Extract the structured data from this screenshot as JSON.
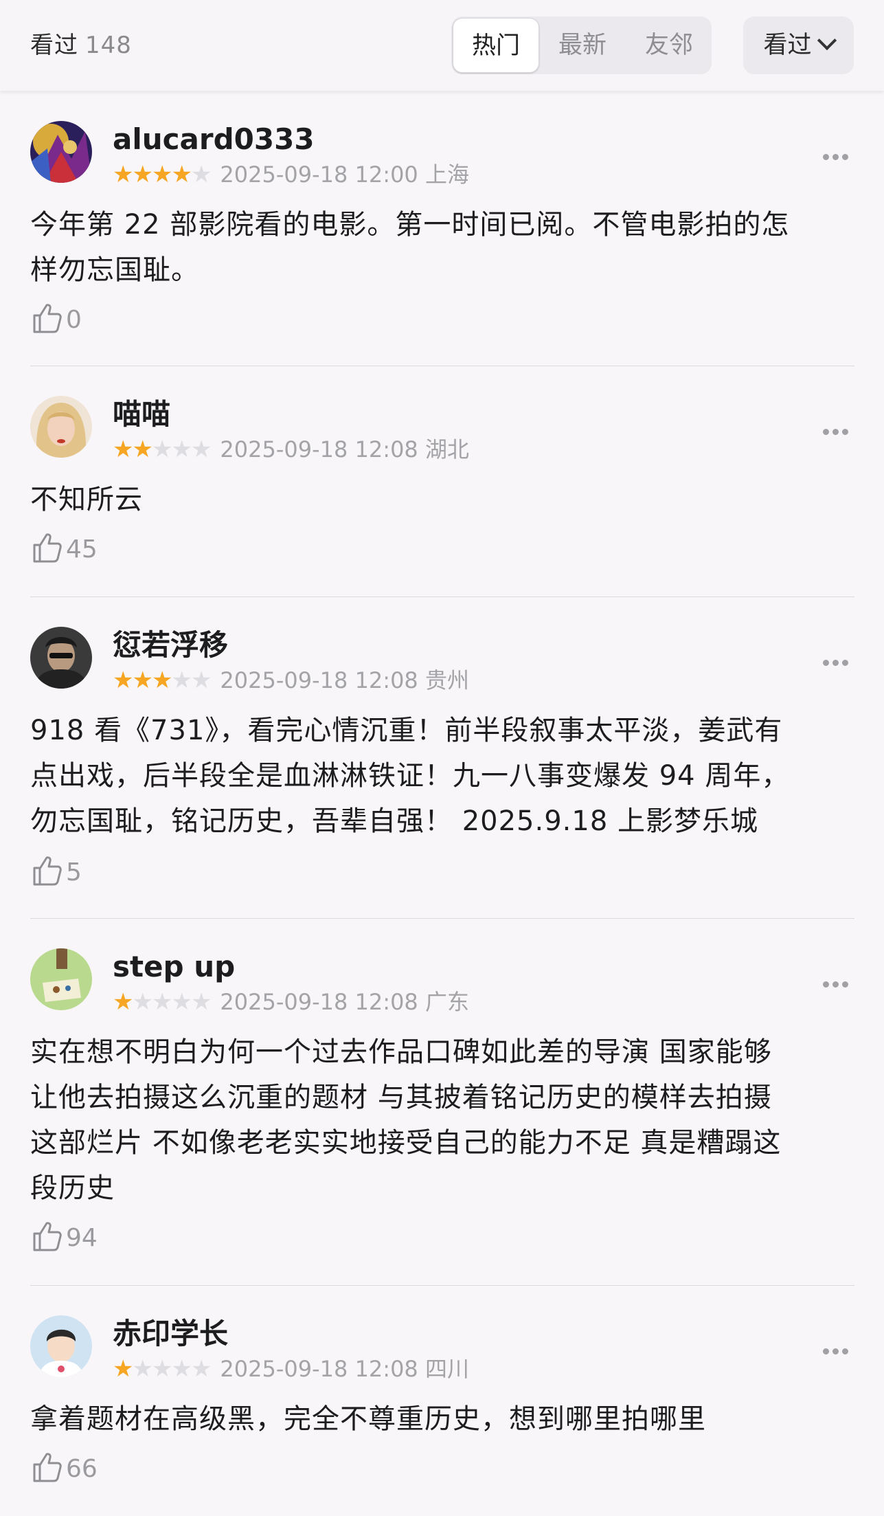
{
  "header": {
    "seen_label": "看过",
    "seen_count": "148",
    "tabs": [
      "热门",
      "最新",
      "友邻"
    ],
    "active_tab": "热门",
    "sort_label": "看过"
  },
  "colors": {
    "star_on": "#f6a623",
    "star_off": "#dedde2"
  },
  "reviews": [
    {
      "user": "alucard0333",
      "stars": 4,
      "date": "2025-09-18 12:00",
      "location": "上海",
      "lines": [
        "今年第 22 部影院看的电影。第一时间已阅。不管电影拍的怎",
        "样勿忘国耻。"
      ],
      "likes": "0"
    },
    {
      "user": "喵喵",
      "stars": 2,
      "date": "2025-09-18 12:08",
      "location": "湖北",
      "lines": [
        "不知所云"
      ],
      "likes": "45"
    },
    {
      "user": "愆若浮移",
      "stars": 3,
      "date": "2025-09-18 12:08",
      "location": "贵州",
      "lines": [
        "918 看《731》，看完心情沉重！前半段叙事太平淡，姜武有",
        "点出戏，后半段全是血淋淋铁证！九一八事变爆发 94 周年，",
        "勿忘国耻，铭记历史，吾辈自强！ 2025.9.18 上影梦乐城"
      ],
      "likes": "5"
    },
    {
      "user": "step up",
      "stars": 1,
      "date": "2025-09-18 12:08",
      "location": "广东",
      "lines": [
        "实在想不明白为何一个过去作品口碑如此差的导演 国家能够",
        "让他去拍摄这么沉重的题材 与其披着铭记历史的模样去拍摄",
        "这部烂片 不如像老老实实地接受自己的能力不足 真是糟蹋这",
        "段历史"
      ],
      "likes": "94"
    },
    {
      "user": "赤印学长",
      "stars": 1,
      "date": "2025-09-18 12:08",
      "location": "四川",
      "lines": [
        "拿着题材在高级黑，完全不尊重历史，想到哪里拍哪里"
      ],
      "likes": "66"
    }
  ]
}
